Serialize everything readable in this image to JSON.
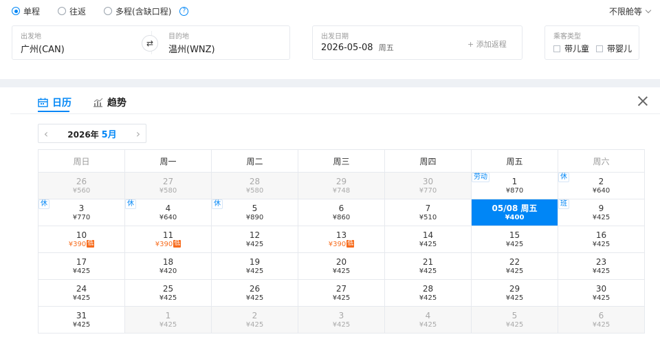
{
  "trip_type": {
    "options": [
      "单程",
      "往返",
      "多程(含缺口程)"
    ],
    "selected": 0,
    "help_icon": "?"
  },
  "cabin": {
    "label": "不限舱等"
  },
  "origin": {
    "label": "出发地",
    "value": "广州(CAN)"
  },
  "destination": {
    "label": "目的地",
    "value": "温州(WNZ)"
  },
  "swap_icon": "⇄",
  "depart_date": {
    "label": "出发日期",
    "date": "2026-05-08",
    "weekday": "周五",
    "add_return": "+ 添加返程"
  },
  "passenger": {
    "label": "乘客类型",
    "options": [
      "带儿童",
      "带婴儿"
    ]
  },
  "tabs": [
    {
      "label": "日历",
      "icon": "calendar-icon"
    },
    {
      "label": "趋势",
      "icon": "trend-chart-icon"
    }
  ],
  "month_selector": {
    "year": "2026年",
    "month": "5月",
    "prev": "‹",
    "next": "›"
  },
  "weekdays": [
    "周日",
    "周一",
    "周二",
    "周三",
    "周四",
    "周五",
    "周六"
  ],
  "low_tag": "低",
  "weeks": [
    [
      {
        "day": "26",
        "price": "¥560",
        "other": true
      },
      {
        "day": "27",
        "price": "¥580",
        "other": true
      },
      {
        "day": "28",
        "price": "¥580",
        "other": true
      },
      {
        "day": "29",
        "price": "¥748",
        "other": true
      },
      {
        "day": "30",
        "price": "¥770",
        "other": true
      },
      {
        "day": "1",
        "price": "¥870",
        "tag": "劳动"
      },
      {
        "day": "2",
        "price": "¥640",
        "tag": "休"
      }
    ],
    [
      {
        "day": "3",
        "price": "¥770",
        "tag": "休"
      },
      {
        "day": "4",
        "price": "¥640",
        "tag": "休"
      },
      {
        "day": "5",
        "price": "¥890",
        "tag": "休"
      },
      {
        "day": "6",
        "price": "¥860"
      },
      {
        "day": "7",
        "price": "¥510"
      },
      {
        "day": "05/08 周五",
        "price": "¥400",
        "selected": true
      },
      {
        "day": "9",
        "price": "¥425",
        "tag": "班"
      }
    ],
    [
      {
        "day": "10",
        "price": "¥390",
        "low": true
      },
      {
        "day": "11",
        "price": "¥390",
        "low": true
      },
      {
        "day": "12",
        "price": "¥425"
      },
      {
        "day": "13",
        "price": "¥390",
        "low": true
      },
      {
        "day": "14",
        "price": "¥425"
      },
      {
        "day": "15",
        "price": "¥425"
      },
      {
        "day": "16",
        "price": "¥425"
      }
    ],
    [
      {
        "day": "17",
        "price": "¥425"
      },
      {
        "day": "18",
        "price": "¥420"
      },
      {
        "day": "19",
        "price": "¥425"
      },
      {
        "day": "20",
        "price": "¥425"
      },
      {
        "day": "21",
        "price": "¥425"
      },
      {
        "day": "22",
        "price": "¥425"
      },
      {
        "day": "23",
        "price": "¥425"
      }
    ],
    [
      {
        "day": "24",
        "price": "¥425"
      },
      {
        "day": "25",
        "price": "¥425"
      },
      {
        "day": "26",
        "price": "¥425"
      },
      {
        "day": "27",
        "price": "¥425"
      },
      {
        "day": "28",
        "price": "¥425"
      },
      {
        "day": "29",
        "price": "¥425"
      },
      {
        "day": "30",
        "price": "¥425"
      }
    ],
    [
      {
        "day": "31",
        "price": "¥425"
      },
      {
        "day": "1",
        "price": "¥425",
        "other": true
      },
      {
        "day": "2",
        "price": "¥425",
        "other": true
      },
      {
        "day": "3",
        "price": "¥425",
        "other": true
      },
      {
        "day": "4",
        "price": "¥425",
        "other": true
      },
      {
        "day": "5",
        "price": "¥425",
        "other": true
      },
      {
        "day": "6",
        "price": "¥425",
        "other": true
      }
    ]
  ],
  "colors": {
    "accent": "#0086f6",
    "low_price": "#f76b1c"
  }
}
